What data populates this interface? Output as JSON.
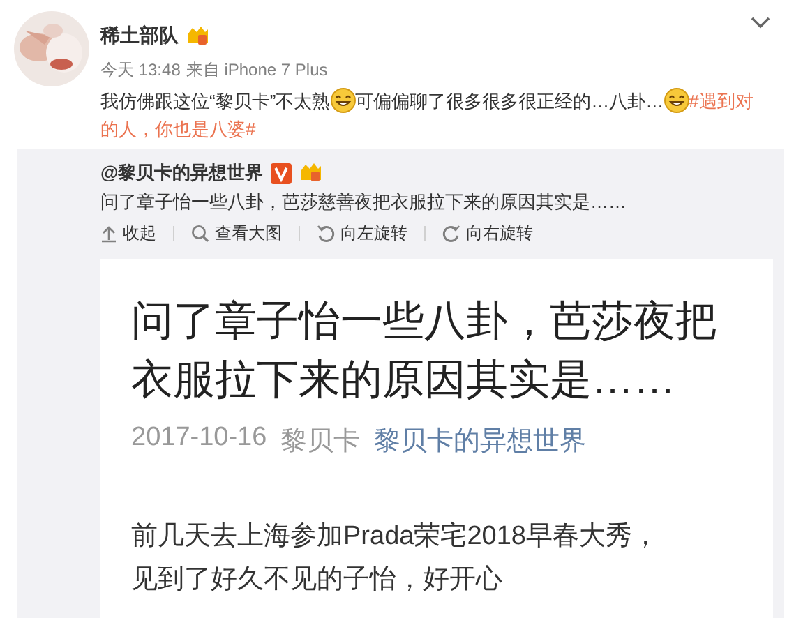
{
  "post": {
    "author": "稀土部队",
    "time": "今天 13:48",
    "source_prefix": "来自",
    "source": "iPhone 7 Plus",
    "content": [
      {
        "kind": "text",
        "text": "我仿佛跟这位“黎贝卡”不太熟"
      },
      {
        "kind": "emoji"
      },
      {
        "kind": "text",
        "text": "可偏偏聊了很多很多很正经的…八卦…"
      },
      {
        "kind": "emoji"
      },
      {
        "kind": "hashtag",
        "text": "#遇到对的人，你也是八婆#"
      }
    ]
  },
  "repost": {
    "author": "@黎贝卡的异想世界",
    "verified": true,
    "text": "问了章子怡一些八卦，芭莎慈善夜把衣服拉下来的原因其实是……",
    "actions": [
      {
        "kind": "collapse",
        "label": "收起"
      },
      {
        "kind": "zoom",
        "label": "查看大图"
      },
      {
        "kind": "rotate-left",
        "label": "向左旋转"
      },
      {
        "kind": "rotate-right",
        "label": "向右旋转"
      }
    ]
  },
  "article": {
    "title_lines": [
      "问了章子怡一些八卦，芭莎夜把",
      "衣服拉下来的原因其实是……"
    ],
    "date": "2017-10-16",
    "author": "黎贝卡",
    "account": "黎贝卡的异想世界",
    "body_lines": [
      "前几天去上海参加Prada荣宅2018早春大秀，",
      "见到了好久不见的子怡，好开心"
    ]
  }
}
